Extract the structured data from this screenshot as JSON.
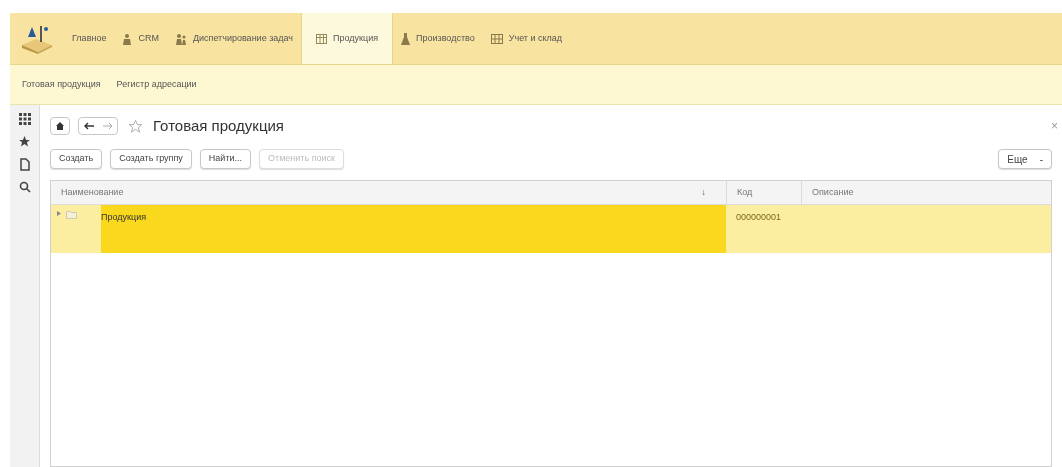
{
  "sections": [
    {
      "label": "Главное",
      "selected": false
    },
    {
      "label": "CRM",
      "selected": false
    },
    {
      "label": "Диспетчирование задач",
      "selected": false
    },
    {
      "label": "Продукция",
      "selected": true
    },
    {
      "label": "Производство",
      "selected": false
    },
    {
      "label": "Учет и склад",
      "selected": false
    }
  ],
  "subnav": [
    "Готовая продукция",
    "Регистр адресации"
  ],
  "form": {
    "title": "Готовая продукция",
    "close": "×",
    "buttons": [
      {
        "label": "Создать",
        "disabled": false
      },
      {
        "label": "Создать группу",
        "disabled": false
      },
      {
        "label": "Найти...",
        "disabled": false
      },
      {
        "label": "Отменить поиск",
        "disabled": true
      }
    ],
    "more": "Еще",
    "more_caret": "-"
  },
  "table": {
    "columns": [
      {
        "label": "Наименование",
        "sort": "↓"
      },
      {
        "label": "Код"
      },
      {
        "label": "Описание"
      }
    ],
    "rows": [
      {
        "name": "Продукция",
        "code": "000000001",
        "selected": true
      }
    ]
  }
}
